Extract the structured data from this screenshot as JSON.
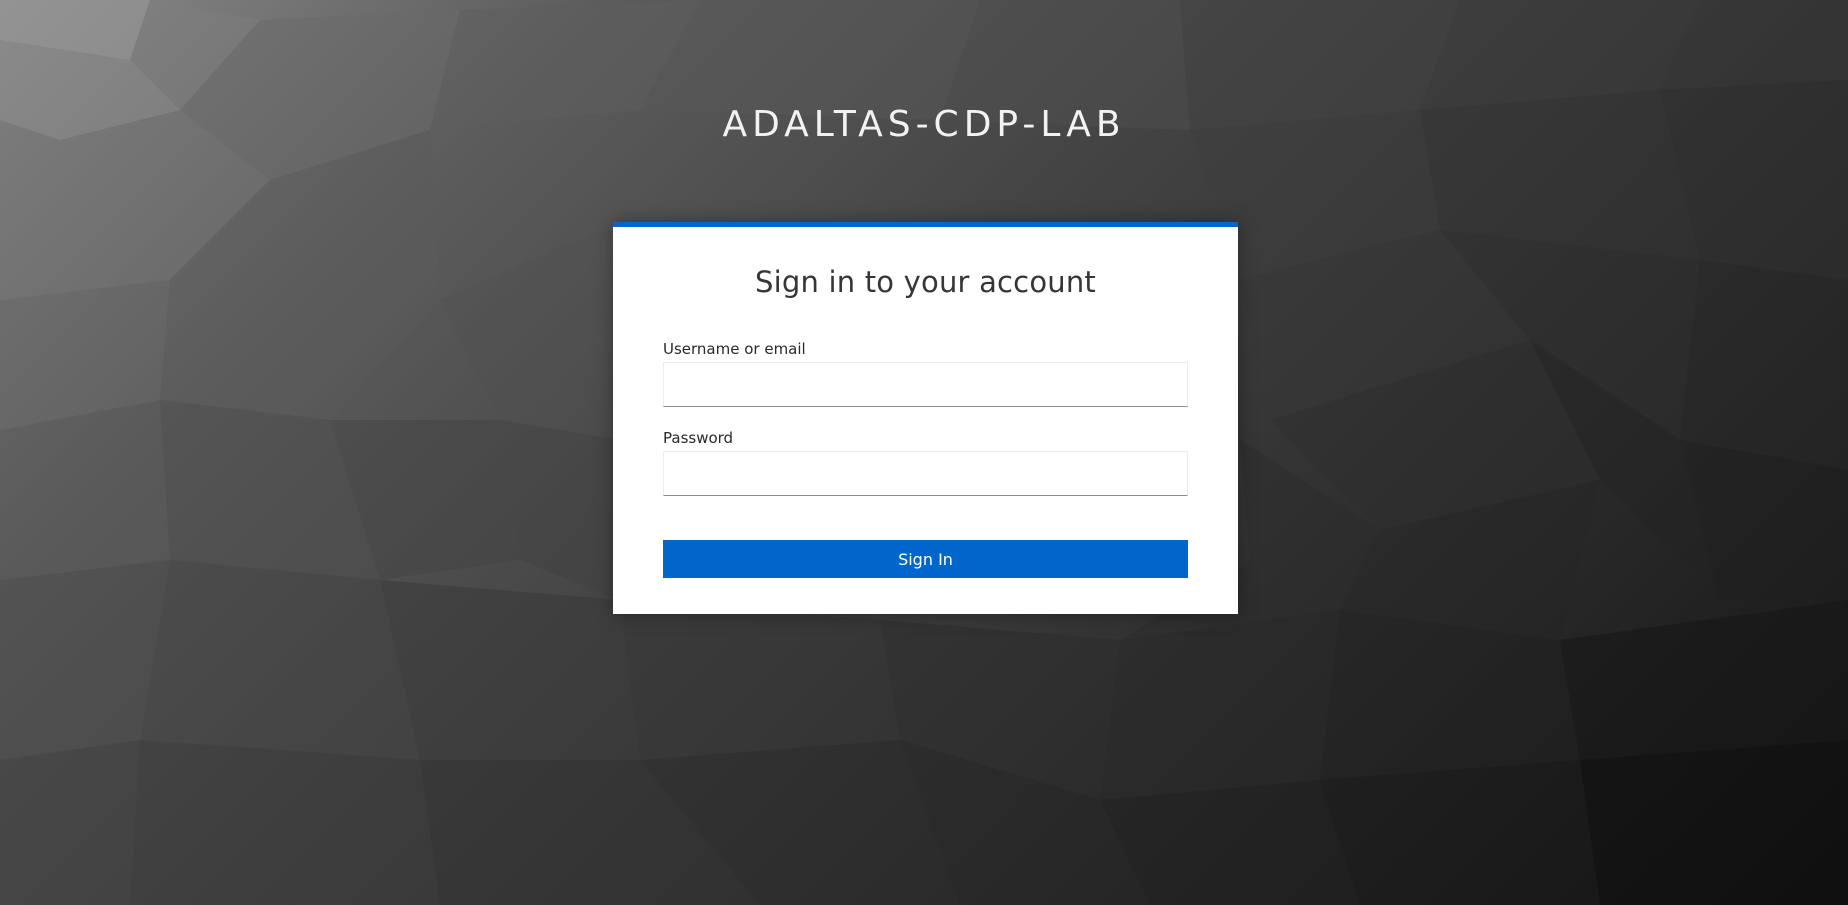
{
  "realm": {
    "title": "ADALTAS-CDP-LAB"
  },
  "login": {
    "header": "Sign in to your account",
    "username_label": "Username or email",
    "username_value": "",
    "password_label": "Password",
    "password_value": "",
    "submit_label": "Sign In"
  },
  "colors": {
    "accent": "#0066cc",
    "card_background": "#ffffff",
    "title_text": "#f2f2f2"
  }
}
